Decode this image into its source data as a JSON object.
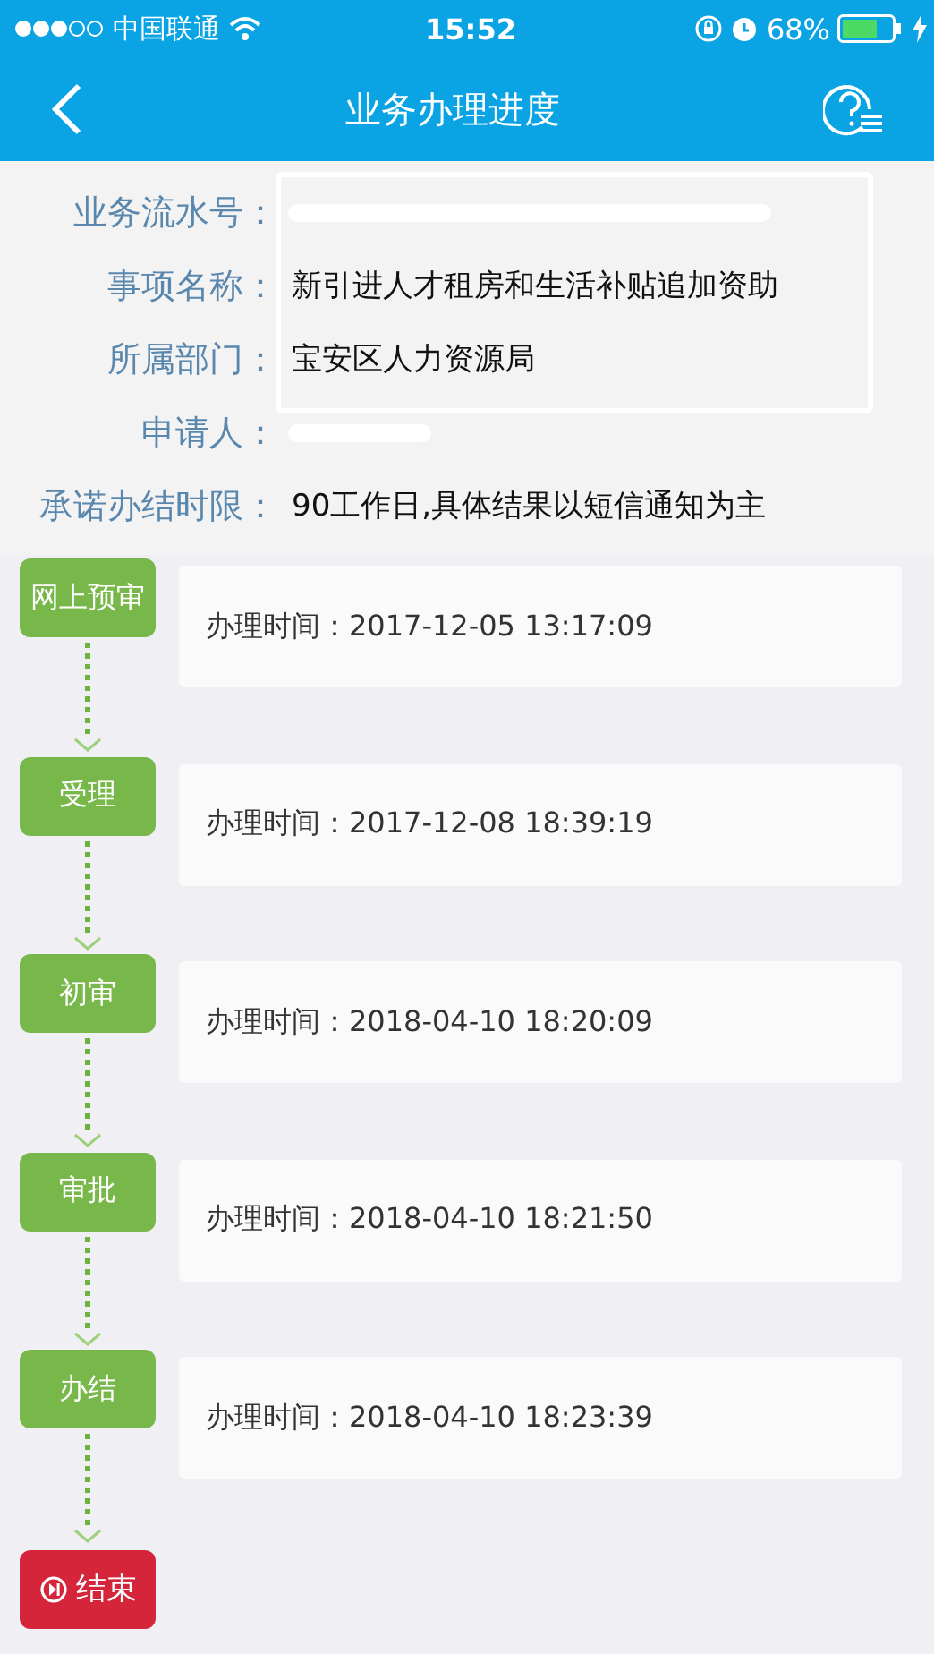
{
  "status_bar": {
    "carrier": "中国联通",
    "time": "15:52",
    "battery": "68%"
  },
  "nav": {
    "title": "业务办理进度"
  },
  "info": [
    {
      "label": "业务流水号：",
      "redacted": true
    },
    {
      "label": "事项名称：",
      "value": "新引进人才租房和生活补贴追加资助",
      "redacted": false
    },
    {
      "label": "所属部门：",
      "value": "宝安区人力资源局",
      "redacted": false
    },
    {
      "label": "申请人：",
      "redacted": true
    },
    {
      "label": "承诺办结时限：",
      "value": "90工作日,具体结果以短信通知为主",
      "redacted": false
    }
  ],
  "steps": [
    {
      "kind": "step",
      "label": "网上预审",
      "text": "办理时间：2017-12-05 13:17:09"
    },
    {
      "kind": "step",
      "label": "受理",
      "text": "办理时间：2017-12-08 18:39:19"
    },
    {
      "kind": "step",
      "label": "初审",
      "text": "办理时间：2018-04-10 18:20:09"
    },
    {
      "kind": "step",
      "label": "审批",
      "text": "办理时间：2018-04-10 18:21:50"
    },
    {
      "kind": "step",
      "label": "办结",
      "text": "办理时间：2018-04-10 18:23:39"
    },
    {
      "kind": "end",
      "label": "结束"
    }
  ]
}
